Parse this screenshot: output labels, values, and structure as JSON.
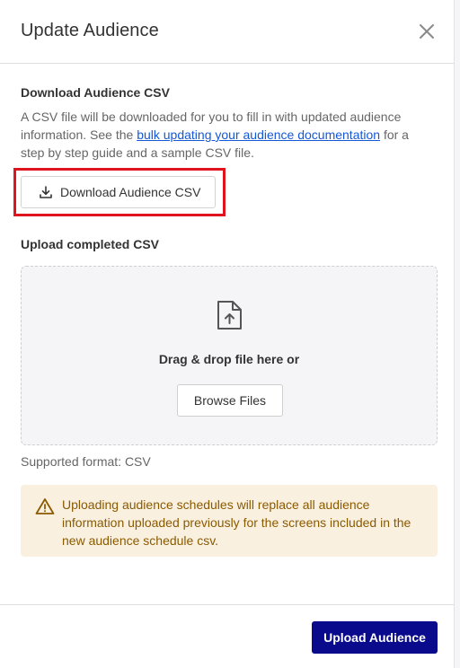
{
  "header": {
    "title": "Update Audience"
  },
  "download_section": {
    "title": "Download Audience CSV",
    "desc_before": "A CSV file will be downloaded for you to fill in with updated audience information. See the ",
    "desc_link": "bulk updating your audience documentation",
    "desc_after": " for a step by step guide and a sample CSV file.",
    "button_label": "Download Audience CSV"
  },
  "upload_section": {
    "title": "Upload completed CSV",
    "drag_text": "Drag & drop file here or",
    "browse_label": "Browse Files",
    "supported": "Supported format: CSV"
  },
  "alert": {
    "text": "Uploading audience schedules will replace all audience information uploaded previously for the screens included in the new audience schedule csv."
  },
  "footer": {
    "upload_label": "Upload Audience"
  },
  "colors": {
    "primary": "#0a0a8c",
    "highlight": "#e0141e",
    "alert_bg": "#faf0e0",
    "alert_text": "#8a5a00"
  }
}
